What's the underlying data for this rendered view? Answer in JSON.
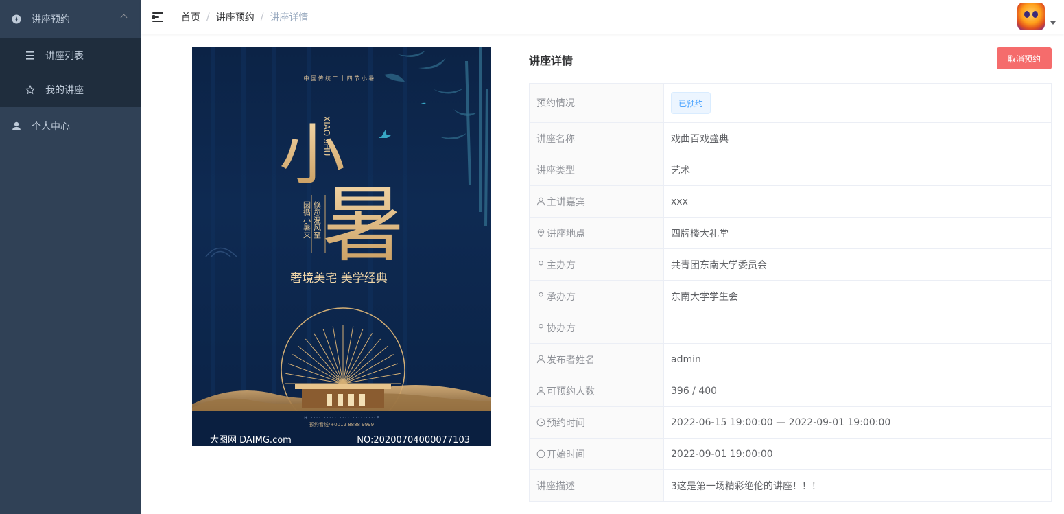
{
  "sidebar": {
    "menu": {
      "label": "讲座预约",
      "icon": "compass-icon",
      "children": [
        {
          "label": "讲座列表",
          "icon": "list-icon"
        },
        {
          "label": "我的讲座",
          "icon": "star-icon"
        }
      ]
    },
    "personal": {
      "label": "个人中心",
      "icon": "user-icon"
    }
  },
  "header": {
    "breadcrumb": [
      "首页",
      "讲座预约",
      "讲座详情"
    ],
    "separator": "/"
  },
  "poster": {
    "top_text": "中 国 传 统 二 十 四 节 小 暑",
    "big_char_1": "小",
    "big_char_2": "暑",
    "pinyin": "XIAO SHU",
    "vertical_1": "倏忽温风至",
    "vertical_2": "因循小暑来",
    "slogan": "奢境美宅  美学经典",
    "hotline": "预约看线/+0012  8888 9999",
    "watermark_left": "大图网 DAIMG.com",
    "watermark_right": "NO:20200704000077103"
  },
  "detail": {
    "title": "讲座详情",
    "cancel_label": "取消预约",
    "status_tag": "已预约",
    "rows": [
      {
        "label": "预约情况",
        "icon": "",
        "value": ""
      },
      {
        "label": "讲座名称",
        "icon": "",
        "value": "戏曲百戏盛典"
      },
      {
        "label": "讲座类型",
        "icon": "",
        "value": "艺术"
      },
      {
        "label": "主讲嘉宾",
        "icon": "user-icon",
        "value": "xxx"
      },
      {
        "label": "讲座地点",
        "icon": "location-icon",
        "value": "四牌楼大礼堂"
      },
      {
        "label": "主办方",
        "icon": "pin-icon",
        "value": "共青团东南大学委员会"
      },
      {
        "label": "承办方",
        "icon": "pin-icon",
        "value": "东南大学学生会"
      },
      {
        "label": "协办方",
        "icon": "pin-icon",
        "value": ""
      },
      {
        "label": "发布者姓名",
        "icon": "user-icon",
        "value": "admin"
      },
      {
        "label": "可预约人数",
        "icon": "user-icon",
        "value": "396 / 400"
      },
      {
        "label": "预约时间",
        "icon": "clock-icon",
        "value": "2022-06-15 19:00:00 — 2022-09-01 19:00:00"
      },
      {
        "label": "开始时间",
        "icon": "clock-icon",
        "value": "2022-09-01 19:00:00"
      },
      {
        "label": "讲座描述",
        "icon": "",
        "value": "3这是第一场精彩绝伦的讲座！！！"
      }
    ]
  },
  "colors": {
    "sidebar_bg": "#304156",
    "submenu_bg": "#1f2d3d",
    "danger": "#f56c6c",
    "primary": "#409eff"
  }
}
